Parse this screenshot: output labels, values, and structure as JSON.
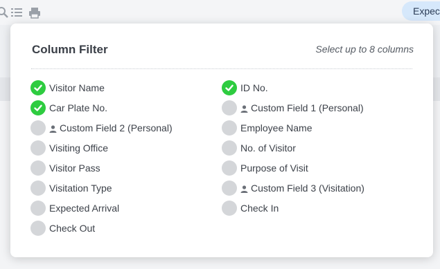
{
  "toolbar": {
    "icons": [
      "search-icon",
      "list-icon",
      "print-icon"
    ],
    "pill_label": "Expec"
  },
  "modal": {
    "title": "Column Filter",
    "hint": "Select up to 8 columns"
  },
  "columns_left": [
    {
      "label": "Visitor Name",
      "checked": true,
      "personal_icon": false
    },
    {
      "label": "Car Plate No.",
      "checked": true,
      "personal_icon": false
    },
    {
      "label": "Custom Field 2 (Personal)",
      "checked": false,
      "personal_icon": true
    },
    {
      "label": "Visiting Office",
      "checked": false,
      "personal_icon": false
    },
    {
      "label": "Visitor Pass",
      "checked": false,
      "personal_icon": false
    },
    {
      "label": "Visitation Type",
      "checked": false,
      "personal_icon": false
    },
    {
      "label": "Expected Arrival",
      "checked": false,
      "personal_icon": false
    },
    {
      "label": "Check Out",
      "checked": false,
      "personal_icon": false
    }
  ],
  "columns_right": [
    {
      "label": "ID No.",
      "checked": true,
      "personal_icon": false
    },
    {
      "label": "Custom Field 1 (Personal)",
      "checked": false,
      "personal_icon": true
    },
    {
      "label": "Employee Name",
      "checked": false,
      "personal_icon": false
    },
    {
      "label": "No. of Visitor",
      "checked": false,
      "personal_icon": false
    },
    {
      "label": "Purpose of Visit",
      "checked": false,
      "personal_icon": false
    },
    {
      "label": "Custom Field 3 (Visitation)",
      "checked": false,
      "personal_icon": true
    },
    {
      "label": "Check In",
      "checked": false,
      "personal_icon": false
    }
  ],
  "colors": {
    "checked": "#2ecc40",
    "unchecked": "#d4d6d9",
    "accent_pill": "#d6e8fb"
  }
}
